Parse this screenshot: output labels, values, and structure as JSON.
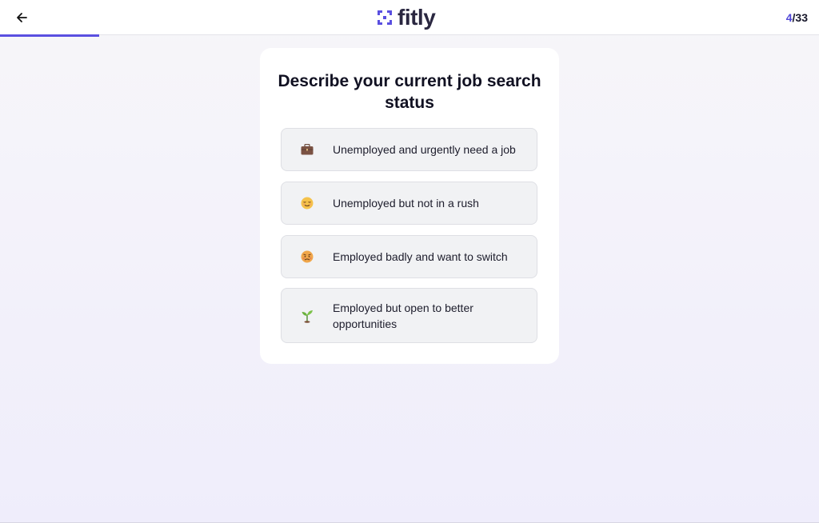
{
  "header": {
    "logo_text": "fitly",
    "step_current": "4",
    "step_total": "/33",
    "progress_fraction": 0.121
  },
  "question": {
    "title": "Describe your current job search status"
  },
  "options": [
    {
      "icon": "briefcase-icon",
      "label": "Unemployed and urgently need a job"
    },
    {
      "icon": "relieved-face-icon",
      "label": "Unemployed but not in a rush"
    },
    {
      "icon": "disappointed-face-icon",
      "label": "Employed badly and want to switch"
    },
    {
      "icon": "seedling-icon",
      "label": "Employed but open to better opportunities"
    }
  ],
  "colors": {
    "accent": "#5a4fe0",
    "option_bg": "#f1f2f4",
    "logo_mark": "#5a4fe0"
  }
}
